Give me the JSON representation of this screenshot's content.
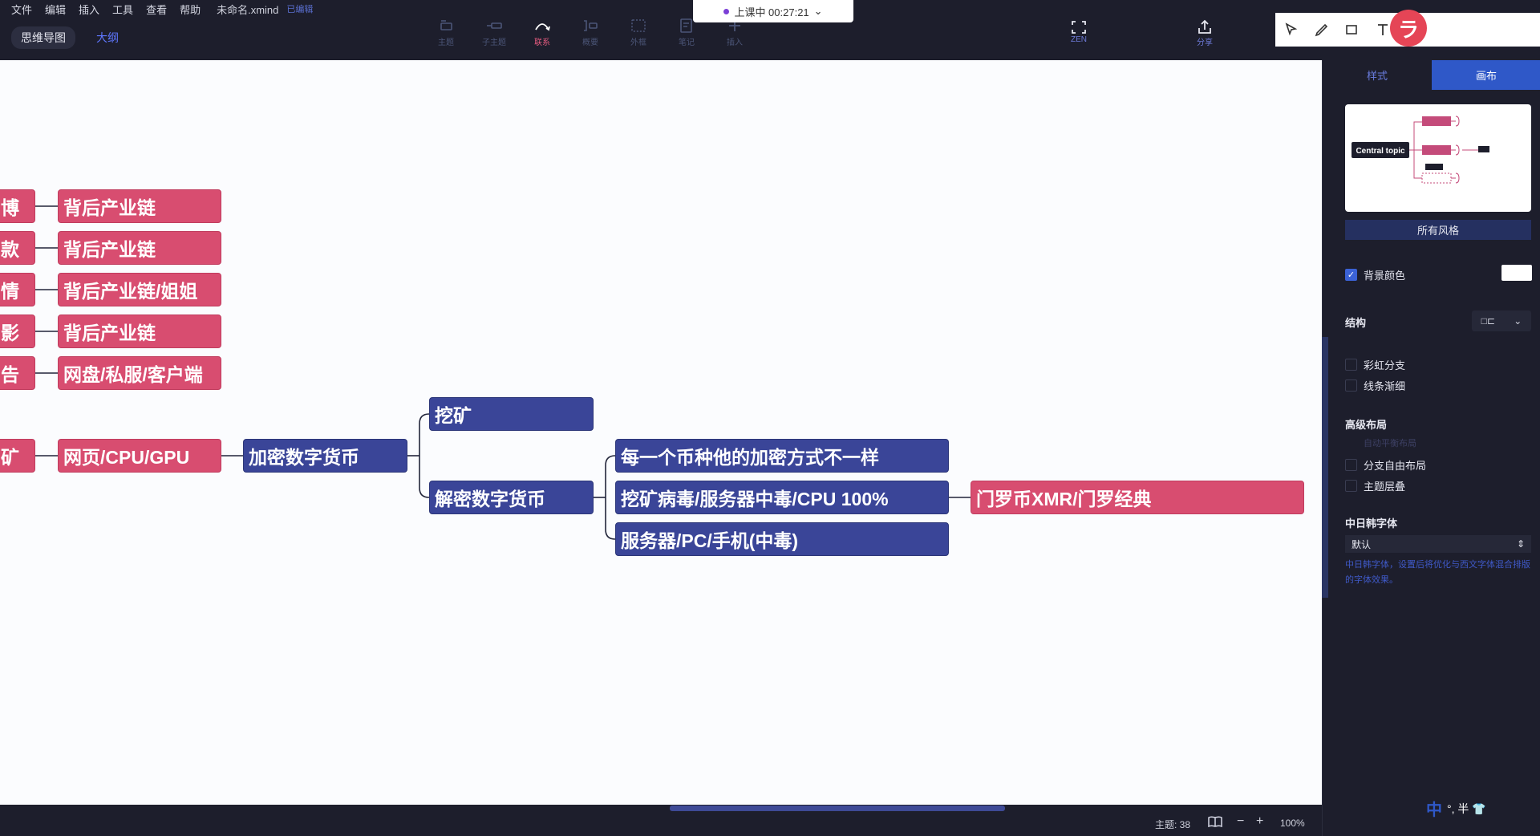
{
  "menu": {
    "items": [
      "文件",
      "编辑",
      "插入",
      "工具",
      "查看",
      "帮助"
    ],
    "filename": "未命名.xmind",
    "save_status": "已编辑"
  },
  "view_tabs": {
    "mindmap": "思维导图",
    "outline": "大纲"
  },
  "timer": {
    "label": "上课中 00:27:21"
  },
  "toolbar": {
    "tools": [
      {
        "label": "主题",
        "icon": "topic-icon"
      },
      {
        "label": "子主题",
        "icon": "subtopic-icon"
      },
      {
        "label": "联系",
        "icon": "relationship-icon"
      },
      {
        "label": "概要",
        "icon": "summary-icon"
      },
      {
        "label": "外框",
        "icon": "boundary-icon"
      },
      {
        "label": "笔记",
        "icon": "note-icon"
      },
      {
        "label": "插入",
        "icon": "insert-icon"
      }
    ],
    "zen": "ZEN",
    "share": "分享"
  },
  "mindmap": {
    "left_fragments": [
      "博",
      "款",
      "情",
      "影",
      "告",
      "矿"
    ],
    "pink_nodes": [
      "背后产业链",
      "背后产业链",
      "背后产业链/姐姐",
      "背后产业链",
      "网盘/私服/客户端"
    ],
    "gpu_node": "网页/CPU/GPU",
    "crypto_node": "加密数字货币",
    "mining_node": "挖矿",
    "decrypt_node": "解密数字货币",
    "children": [
      "每一个币种他的加密方式不一样",
      "挖矿病毒/服务器中毒/CPU 100%",
      "服务器/PC/手机(中毒)"
    ],
    "monero_node": "门罗币XMR/门罗经典"
  },
  "status": {
    "topic_count": "主题: 38",
    "zoom_minus": "−",
    "zoom_plus": "+",
    "zoom": "100%"
  },
  "panel": {
    "tabs": {
      "style": "样式",
      "canvas": "画布"
    },
    "preview": {
      "central_topic": "Central topic"
    },
    "all_styles": "所有风格",
    "bg_color": "背景颜色",
    "structure": "结构",
    "rainbow_branch": "彩虹分支",
    "line_taper": "线条渐细",
    "advanced_layout": "高级布局",
    "auto_balance": "自动平衡布局",
    "free_branch": "分支自由布局",
    "topic_overlap": "主题层叠",
    "cjk_font": "中日韩字体",
    "font_default": "默认",
    "font_desc": "中日韩字体，设置后将优化与西文字体混合排版的字体效果。"
  },
  "colors": {
    "pink": "#d84d70",
    "blue": "#3a4598",
    "accent": "#2f58c8"
  }
}
